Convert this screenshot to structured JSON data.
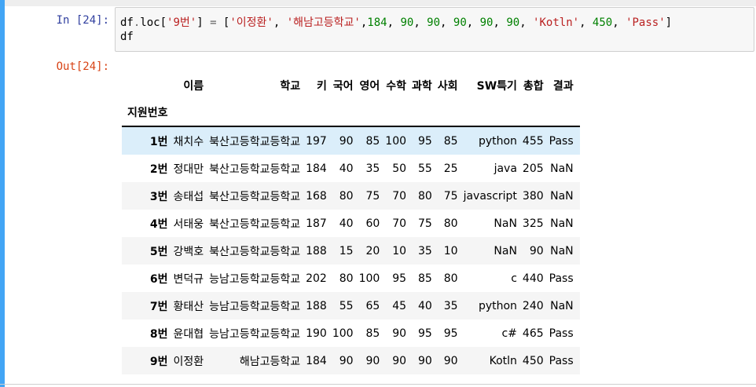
{
  "input": {
    "prompt": "In [24]:",
    "line1": [
      {
        "t": "df",
        "c": "txt"
      },
      {
        "t": ".",
        "c": "op"
      },
      {
        "t": "loc",
        "c": "txt"
      },
      {
        "t": "[",
        "c": "txt"
      },
      {
        "t": "'9번'",
        "c": "str"
      },
      {
        "t": "] ",
        "c": "txt"
      },
      {
        "t": "=",
        "c": "op"
      },
      {
        "t": " [",
        "c": "txt"
      },
      {
        "t": "'이정환'",
        "c": "str"
      },
      {
        "t": ", ",
        "c": "txt"
      },
      {
        "t": "'해남고등학교'",
        "c": "str"
      },
      {
        "t": ",",
        "c": "txt"
      },
      {
        "t": "184",
        "c": "num"
      },
      {
        "t": ", ",
        "c": "txt"
      },
      {
        "t": "90",
        "c": "num"
      },
      {
        "t": ", ",
        "c": "txt"
      },
      {
        "t": "90",
        "c": "num"
      },
      {
        "t": ", ",
        "c": "txt"
      },
      {
        "t": "90",
        "c": "num"
      },
      {
        "t": ", ",
        "c": "txt"
      },
      {
        "t": "90",
        "c": "num"
      },
      {
        "t": ", ",
        "c": "txt"
      },
      {
        "t": "90",
        "c": "num"
      },
      {
        "t": ", ",
        "c": "txt"
      },
      {
        "t": "'Kotln'",
        "c": "str"
      },
      {
        "t": ", ",
        "c": "txt"
      },
      {
        "t": "450",
        "c": "num"
      },
      {
        "t": ", ",
        "c": "txt"
      },
      {
        "t": "'Pass'",
        "c": "str"
      },
      {
        "t": "]",
        "c": "txt"
      }
    ],
    "line2": "df"
  },
  "output": {
    "prompt": "Out[24]:",
    "columns": [
      "이름",
      "학교",
      "키",
      "국어",
      "영어",
      "수학",
      "과학",
      "사회",
      "SW특기",
      "총합",
      "결과"
    ],
    "index_name": "지원번호",
    "highlighted_row": 0,
    "rows": [
      {
        "idx": "1번",
        "cells": [
          "채치수",
          "북산고등학교등학교",
          "197",
          "90",
          "85",
          "100",
          "95",
          "85",
          "python",
          "455",
          "Pass"
        ]
      },
      {
        "idx": "2번",
        "cells": [
          "정대만",
          "북산고등학교등학교",
          "184",
          "40",
          "35",
          "50",
          "55",
          "25",
          "java",
          "205",
          "NaN"
        ]
      },
      {
        "idx": "3번",
        "cells": [
          "송태섭",
          "북산고등학교등학교",
          "168",
          "80",
          "75",
          "70",
          "80",
          "75",
          "javascript",
          "380",
          "NaN"
        ]
      },
      {
        "idx": "4번",
        "cells": [
          "서태웅",
          "북산고등학교등학교",
          "187",
          "40",
          "60",
          "70",
          "75",
          "80",
          "NaN",
          "325",
          "NaN"
        ]
      },
      {
        "idx": "5번",
        "cells": [
          "강백호",
          "북산고등학교등학교",
          "188",
          "15",
          "20",
          "10",
          "35",
          "10",
          "NaN",
          "90",
          "NaN"
        ]
      },
      {
        "idx": "6번",
        "cells": [
          "변덕규",
          "능남고등학교등학교",
          "202",
          "80",
          "100",
          "95",
          "85",
          "80",
          "c",
          "440",
          "Pass"
        ]
      },
      {
        "idx": "7번",
        "cells": [
          "황태산",
          "능남고등학교등학교",
          "188",
          "55",
          "65",
          "45",
          "40",
          "35",
          "python",
          "240",
          "NaN"
        ]
      },
      {
        "idx": "8번",
        "cells": [
          "윤대협",
          "능남고등학교등학교",
          "190",
          "100",
          "85",
          "90",
          "95",
          "95",
          "c#",
          "465",
          "Pass"
        ]
      },
      {
        "idx": "9번",
        "cells": [
          "이정환",
          "해남고등학교",
          "184",
          "90",
          "90",
          "90",
          "90",
          "90",
          "Kotln",
          "450",
          "Pass"
        ]
      }
    ]
  },
  "colors": {
    "cell_border": "#42a5f5",
    "in_prompt": "#303f9f",
    "out_prompt": "#d84315",
    "string": "#ba2121",
    "number": "#008000",
    "row_highlight": "#dbeefa"
  }
}
